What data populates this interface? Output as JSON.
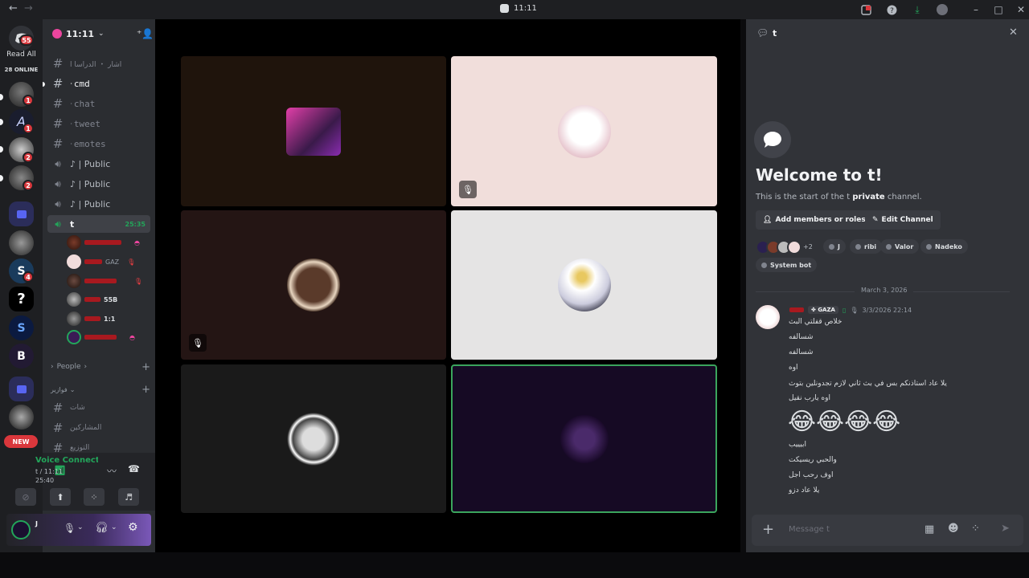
{
  "window": {
    "title": "11:11",
    "back_icon": "arrow-left-icon",
    "forward_icon": "arrow-right-icon"
  },
  "titlebar_icons": [
    "inbox-icon",
    "help-icon",
    "download-icon",
    "avatar-icon",
    "minimize-icon",
    "maximize-icon",
    "close-icon"
  ],
  "rail": {
    "dm_badge": "55",
    "read_all": "Read All",
    "online": "28 ONLINE",
    "badges": [
      "1",
      "1",
      "2",
      "2",
      "4"
    ],
    "new_label": "NEW"
  },
  "server": {
    "name": "11:11"
  },
  "channels": [
    {
      "label": "اشار ・ الدراسا ا",
      "kind": "text"
    },
    {
      "label": "cmd",
      "kind": "text"
    },
    {
      "label": "chat",
      "kind": "text"
    },
    {
      "label": "tweet",
      "kind": "text"
    },
    {
      "label": "emotes",
      "kind": "text"
    },
    {
      "label": "♪ | Public",
      "kind": "voice"
    },
    {
      "label": "♪ | Public",
      "kind": "voice"
    },
    {
      "label": "♪ | Public",
      "kind": "voice"
    }
  ],
  "voice_channel": {
    "label": "t",
    "timer": "25:35"
  },
  "voice_users": [
    {
      "tag": ""
    },
    {
      "tag": "GAZ"
    },
    {
      "tag": ""
    },
    {
      "tag": "55B"
    },
    {
      "tag": "1:1"
    },
    {
      "tag": ""
    }
  ],
  "categories": {
    "people": "People",
    "other": "فوازير"
  },
  "lower_channels": [
    "شات",
    "المشاركين",
    "التوزيع"
  ],
  "voice_status": {
    "title": "Voice Connected",
    "subtitle": "t / 11:11",
    "time": "25:40"
  },
  "user_panel": {
    "name": "J"
  },
  "panel": {
    "channel": "t",
    "welcome": "Welcome to t!",
    "intro_pre": "This is the start of the t ",
    "intro_bold": "private",
    "intro_post": " channel.",
    "add_members": "Add members or roles",
    "edit_channel": "Edit Channel",
    "extra_members": "+2",
    "members": [
      "J",
      "ribi",
      "Valor",
      "Nadeko",
      "System bot"
    ],
    "date_divider": "March 3, 2026",
    "message": {
      "author_tag": "GAZA",
      "timestamp": "3/3/2026 22:14",
      "lines": [
        "خلاص قفلتي البث",
        "شسالفه",
        "شسالفه",
        "اوه",
        "يلا عاد استاذنكم بس في بث ثاني لازم تجدونلين بتوث",
        "اوه يارب نقيل"
      ],
      "emoji": "😂😂😂😂",
      "lines2": [
        "ابيييب",
        "والحبي ريسيكت",
        "اوف رحب اجل",
        "يلا عاد دزو"
      ]
    },
    "composer_placeholder": "Message t"
  },
  "colors": {
    "accent": "#23a55a",
    "danger": "#da373c",
    "blurple": "#5865f2"
  }
}
